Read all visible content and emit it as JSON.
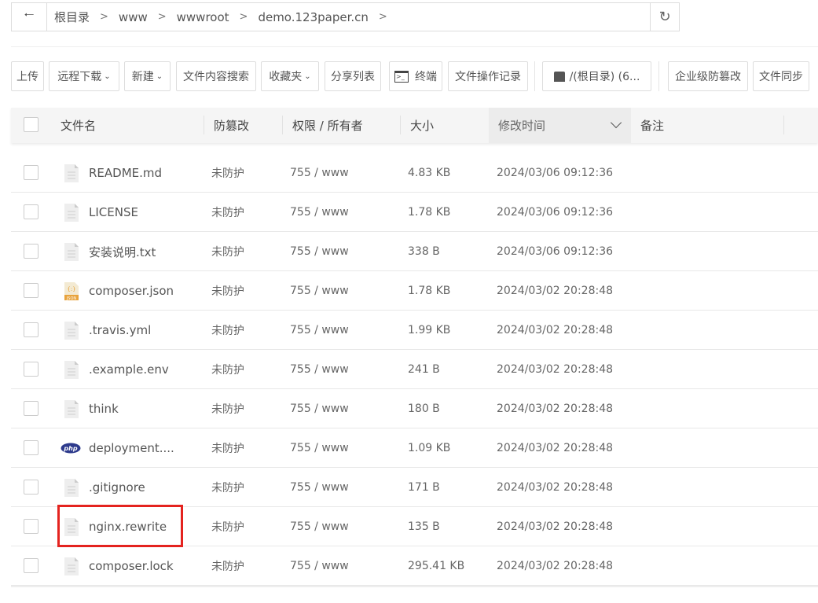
{
  "breadcrumb": {
    "items": [
      "根目录",
      "www",
      "wwwroot",
      "demo.123paper.cn"
    ]
  },
  "toolbar": {
    "upload": "上传",
    "remote_download": "远程下载",
    "new": "新建",
    "content_search": "文件内容搜索",
    "favorites": "收藏夹",
    "share_list": "分享列表",
    "terminal": "终端",
    "operation_log": "文件操作记录",
    "disk": "/(根目录) (6...",
    "tamper_proof": "企业级防篡改",
    "file_sync": "文件同步"
  },
  "columns": {
    "name": "文件名",
    "protect": "防篡改",
    "perm": "权限 / 所有者",
    "size": "大小",
    "mtime": "修改时间",
    "remark": "备注"
  },
  "files": [
    {
      "name": "README.md",
      "protect": "未防护",
      "perm": "755 / www",
      "size": "4.83 KB",
      "mtime": "2024/03/06 09:12:36",
      "icon": "file-icon"
    },
    {
      "name": "LICENSE",
      "protect": "未防护",
      "perm": "755 / www",
      "size": "1.78 KB",
      "mtime": "2024/03/06 09:12:36",
      "icon": "file-icon"
    },
    {
      "name": "安装说明.txt",
      "protect": "未防护",
      "perm": "755 / www",
      "size": "338 B",
      "mtime": "2024/03/06 09:12:36",
      "icon": "file-icon"
    },
    {
      "name": "composer.json",
      "protect": "未防护",
      "perm": "755 / www",
      "size": "1.78 KB",
      "mtime": "2024/03/02 20:28:48",
      "icon": "json-icon"
    },
    {
      "name": ".travis.yml",
      "protect": "未防护",
      "perm": "755 / www",
      "size": "1.99 KB",
      "mtime": "2024/03/02 20:28:48",
      "icon": "file-icon"
    },
    {
      "name": ".example.env",
      "protect": "未防护",
      "perm": "755 / www",
      "size": "241 B",
      "mtime": "2024/03/02 20:28:48",
      "icon": "file-icon"
    },
    {
      "name": "think",
      "protect": "未防护",
      "perm": "755 / www",
      "size": "180 B",
      "mtime": "2024/03/02 20:28:48",
      "icon": "file-icon"
    },
    {
      "name": "deployment....",
      "protect": "未防护",
      "perm": "755 / www",
      "size": "1.09 KB",
      "mtime": "2024/03/02 20:28:48",
      "icon": "php-icon"
    },
    {
      "name": ".gitignore",
      "protect": "未防护",
      "perm": "755 / www",
      "size": "171 B",
      "mtime": "2024/03/02 20:28:48",
      "icon": "file-icon"
    },
    {
      "name": "nginx.rewrite",
      "protect": "未防护",
      "perm": "755 / www",
      "size": "135 B",
      "mtime": "2024/03/02 20:28:48",
      "icon": "file-icon"
    },
    {
      "name": "composer.lock",
      "protect": "未防护",
      "perm": "755 / www",
      "size": "295.41 KB",
      "mtime": "2024/03/02 20:28:48",
      "icon": "file-icon"
    }
  ],
  "highlight_color": "#e4231f"
}
